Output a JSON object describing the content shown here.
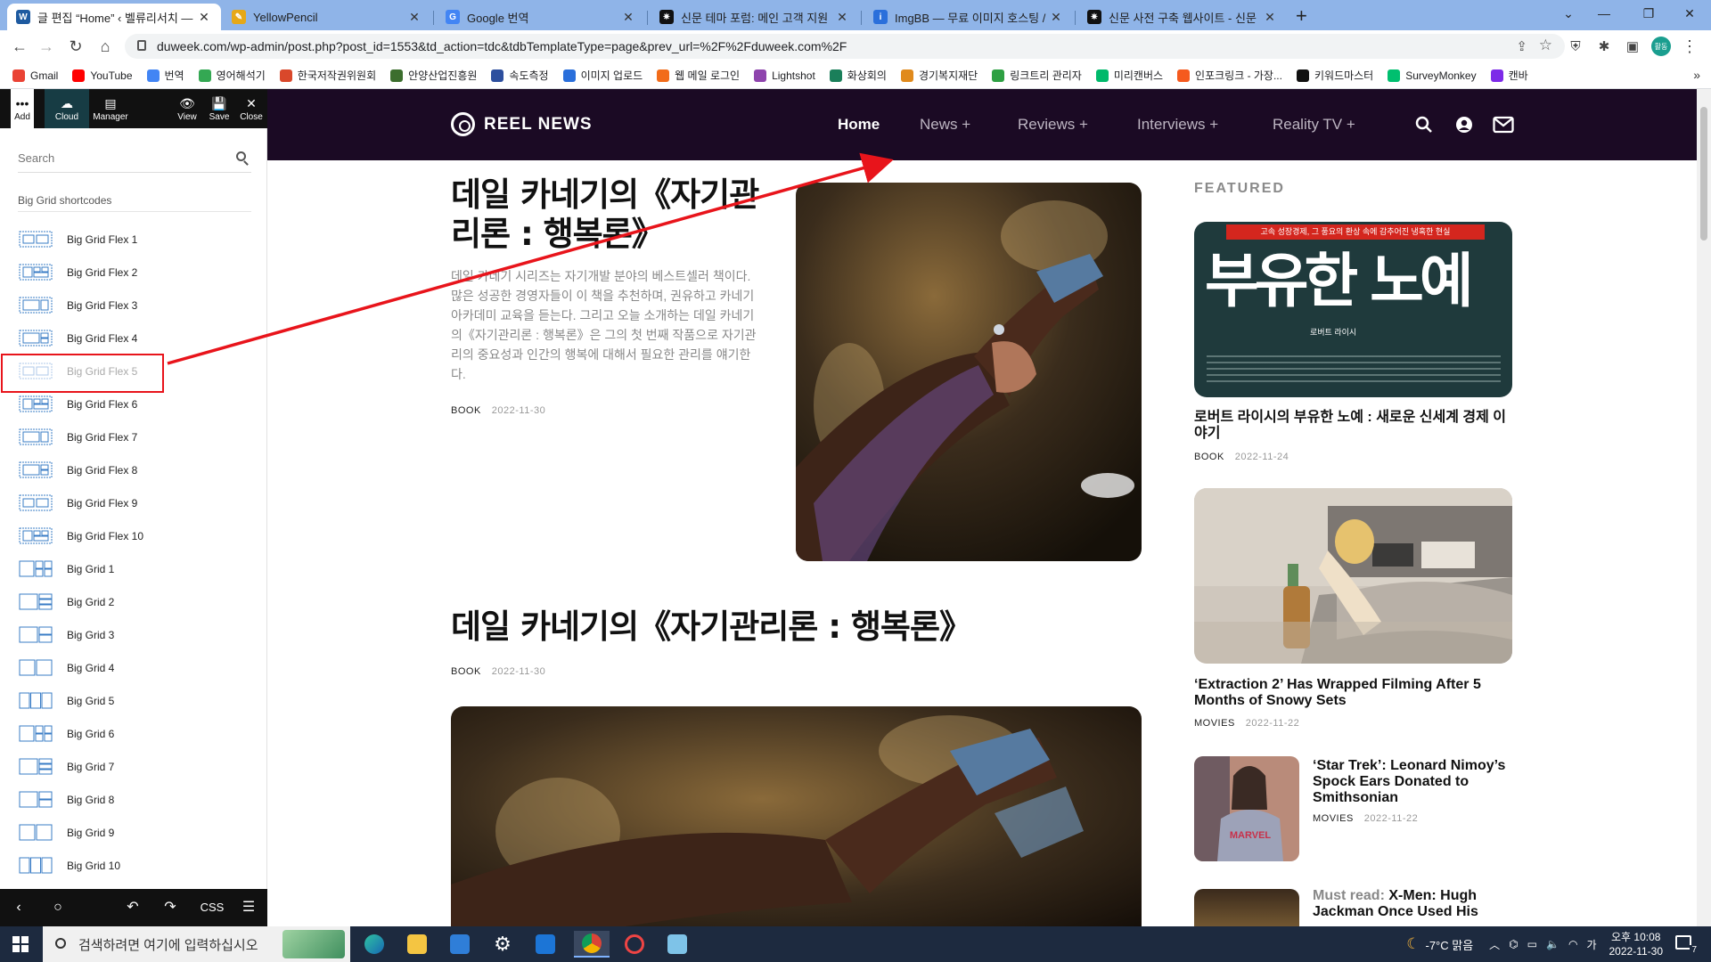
{
  "browser": {
    "tabs": [
      {
        "title": "글 편집 “Home” ‹ 벨류리서치 —",
        "favicon_color": "#1e5aa0",
        "favicon_char": "W",
        "active": true
      },
      {
        "title": "YellowPencil",
        "favicon_color": "#e6a817",
        "favicon_char": "✎",
        "active": false
      },
      {
        "title": "Google 번역",
        "favicon_color": "#4285f4",
        "favicon_char": "G",
        "active": false
      },
      {
        "title": "신문 테마 포럼: 메인 고객 지원",
        "favicon_color": "#111111",
        "favicon_char": "✷",
        "active": false
      },
      {
        "title": "ImgBB — 무료 이미지 호스팅 /",
        "favicon_color": "#2a6fdb",
        "favicon_char": "i",
        "active": false
      },
      {
        "title": "신문 사전 구축 웹사이트 - 신문",
        "favicon_color": "#111111",
        "favicon_char": "✷",
        "active": false
      }
    ],
    "new_tab": "+",
    "url": "duweek.com/wp-admin/post.php?post_id=1553&td_action=tdc&tdbTemplateType=page&prev_url=%2F%2Fduweek.com%2F",
    "profile_initials": "활동",
    "bookmarks": [
      {
        "label": "Gmail",
        "color": "#ea4335"
      },
      {
        "label": "YouTube",
        "color": "#ff0000"
      },
      {
        "label": "번역",
        "color": "#4285f4"
      },
      {
        "label": "영어해석기",
        "color": "#34a853"
      },
      {
        "label": "한국저작권위원회",
        "color": "#d9482b"
      },
      {
        "label": "안양산업진흥원",
        "color": "#3c6e2e"
      },
      {
        "label": "속도측정",
        "color": "#2d4f9e"
      },
      {
        "label": "이미지 업로드",
        "color": "#2a6fdb"
      },
      {
        "label": "웹 메일 로그인",
        "color": "#f26c1a"
      },
      {
        "label": "Lightshot",
        "color": "#8e44ad"
      },
      {
        "label": "화상회의",
        "color": "#1a7f5a"
      },
      {
        "label": "경기복지재단",
        "color": "#e08a1c"
      },
      {
        "label": "링크트리 관리자",
        "color": "#2ea043"
      },
      {
        "label": "미리캔버스",
        "color": "#00b96b"
      },
      {
        "label": "인포크링크 - 가장...",
        "color": "#f55a1e"
      },
      {
        "label": "키워드마스터",
        "color": "#111111"
      },
      {
        "label": "SurveyMonkey",
        "color": "#00bf6f"
      },
      {
        "label": "캔바",
        "color": "#7d2ae8"
      }
    ],
    "bookmarks_more": "»"
  },
  "editor": {
    "toolbar": [
      {
        "icon": "•••",
        "label": "Add"
      },
      {
        "icon": "☁",
        "label": "Cloud"
      },
      {
        "icon": "▤",
        "label": "Manager"
      },
      {
        "icon": "👁",
        "label": "View"
      },
      {
        "icon": "💾",
        "label": "Save"
      },
      {
        "icon": "✕",
        "label": "Close"
      }
    ],
    "search_placeholder": "Search",
    "section_title": "Big Grid shortcodes",
    "items": [
      "Big Grid Flex 1",
      "Big Grid Flex 2",
      "Big Grid Flex 3",
      "Big Grid Flex 4",
      "Big Grid Flex 5",
      "Big Grid Flex 6",
      "Big Grid Flex 7",
      "Big Grid Flex 8",
      "Big Grid Flex 9",
      "Big Grid Flex 10",
      "Big Grid 1",
      "Big Grid 2",
      "Big Grid 3",
      "Big Grid 4",
      "Big Grid 5",
      "Big Grid 6",
      "Big Grid 7",
      "Big Grid 8",
      "Big Grid 9",
      "Big Grid 10"
    ],
    "highlighted_item": "Big Grid Flex 5",
    "bottom_bar": {
      "back": "‹",
      "circle": "○",
      "undo": "↶",
      "redo": "↷",
      "css": "CSS",
      "menu": "☰"
    }
  },
  "site": {
    "logo": "REEL NEWS",
    "nav": [
      {
        "label": "Home",
        "current": true
      },
      {
        "label": "News +",
        "current": false
      },
      {
        "label": "Reviews +",
        "current": false
      },
      {
        "label": "Interviews +",
        "current": false
      },
      {
        "label": "Reality TV +",
        "current": false
      }
    ],
    "hero": {
      "title": "데일 카네기의《자기관리론 : 행복론》",
      "excerpt": "데일 카네기 시리즈는 자기개발 분야의 베스트셀러 책이다. 많은 성공한 경영자들이 이 책을 추천하며, 권유하고 카네기 아카데미 교육을 듣는다. 그리고 오늘 소개하는 데일 카네기의《자기관리론 : 행복론》은 그의 첫 번째 작품으로 자기관리의 중요성과 인간의 행복에 대해서 필요한 관리를 얘기한다.",
      "category": "BOOK",
      "date": "2022-11-30"
    },
    "second": {
      "title": "데일 카네기의《자기관리론 : 행복론》",
      "category": "BOOK",
      "date": "2022-11-30"
    },
    "featured_heading": "FEATURED",
    "featured": [
      {
        "cover_top": "고속 성장경제, 그 풍요의 환상 속에 감추어진 냉혹한 현실",
        "cover_title": "부유한 노예",
        "cover_author": "로버트 라이시",
        "title": "로버트 라이시의 부유한 노예 : 새로운 신세계 경제 이야기",
        "category": "BOOK",
        "date": "2022-11-24"
      },
      {
        "title": "‘Extraction 2’ Has Wrapped Filming After 5 Months of Snowy Sets",
        "category": "MOVIES",
        "date": "2022-11-22"
      },
      {
        "title": "‘Star Trek’: Leonard Nimoy’s Spock Ears Donated to Smithsonian",
        "category": "MOVIES",
        "date": "2022-11-22",
        "shirt_text": "MARVEL"
      },
      {
        "prefix": "Must read:",
        "title": "X-Men: Hugh Jackman Once Used His"
      }
    ]
  },
  "taskbar": {
    "search_placeholder": "검색하려면 여기에 입력하십시오",
    "weather": "-7°C 맑음",
    "ime": "가",
    "time": "오후 10:08",
    "date": "2022-11-30",
    "notifications": "7"
  }
}
